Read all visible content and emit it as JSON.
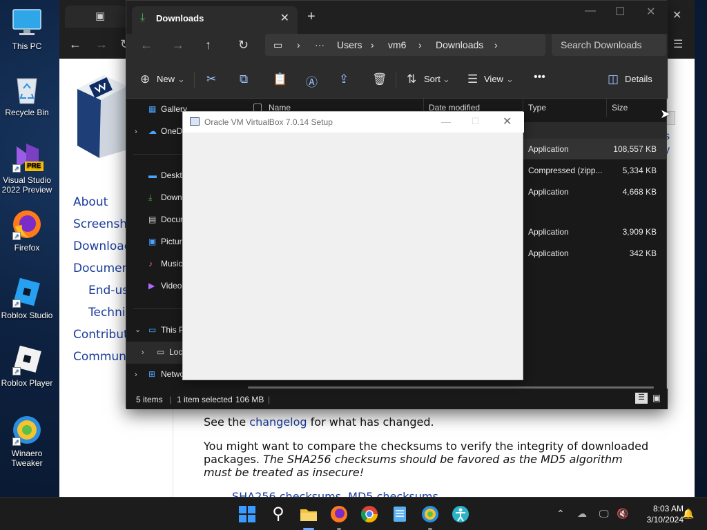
{
  "desktop": {
    "icons": [
      {
        "label": "This PC"
      },
      {
        "label": "Recycle Bin"
      },
      {
        "label": "Visual Studio 2022 Preview",
        "badge": "PRE"
      },
      {
        "label": "Firefox"
      },
      {
        "label": "Roblox Studio"
      },
      {
        "label": "Roblox Player"
      },
      {
        "label": "Winaero Tweaker"
      }
    ]
  },
  "browser": {
    "sidebar_links": [
      "About",
      "Screenshots",
      "Downloads",
      "Documentation",
      "End-user docs",
      "Technical docs",
      "Contribute",
      "Community"
    ],
    "body": {
      "changelog_prefix": "See the ",
      "changelog_link": "changelog",
      "changelog_suffix": " for what has changed.",
      "checksum_line1": "You might want to compare the checksums to verify the integrity of downloaded",
      "checksum_line2_plain": "packages. ",
      "checksum_line2_italic": "The SHA256 checksums should be favored as the MD5 algorithm",
      "checksum_line3_italic": "must be treated as insecure!",
      "partial_bottom": "SHA256 checksums, MD5 checksums"
    },
    "right_fragments": [
      "s",
      "y"
    ]
  },
  "explorer": {
    "tab_title": "Downloads",
    "breadcrumb": [
      "Users",
      "vm6",
      "Downloads"
    ],
    "search_placeholder": "Search Downloads",
    "commands": {
      "new": "New",
      "sort": "Sort",
      "view": "View",
      "details": "Details"
    },
    "nav_items": [
      "Gallery",
      "OneDrive",
      "Desktop",
      "Downloads",
      "Documents",
      "Pictures",
      "Music",
      "Videos",
      "This PC",
      "Local Disk",
      "Network"
    ],
    "columns": [
      "Name",
      "Date modified",
      "Type",
      "Size"
    ],
    "files": [
      {
        "type": "Application",
        "size": "108,557 KB",
        "selected": true
      },
      {
        "type": "Compressed (zipp...",
        "size": "5,334 KB"
      },
      {
        "type": "Application",
        "size": "4,668 KB"
      },
      {
        "type": "Application",
        "size": "3,909 KB"
      },
      {
        "type": "Application",
        "size": "342 KB"
      }
    ],
    "status": {
      "count": "5 items",
      "selected": "1 item selected",
      "size": "106 MB"
    }
  },
  "dialog": {
    "title": "Oracle VM VirtualBox 7.0.14 Setup"
  },
  "taskbar": {
    "time": "8:03 AM",
    "date": "3/10/2024"
  }
}
